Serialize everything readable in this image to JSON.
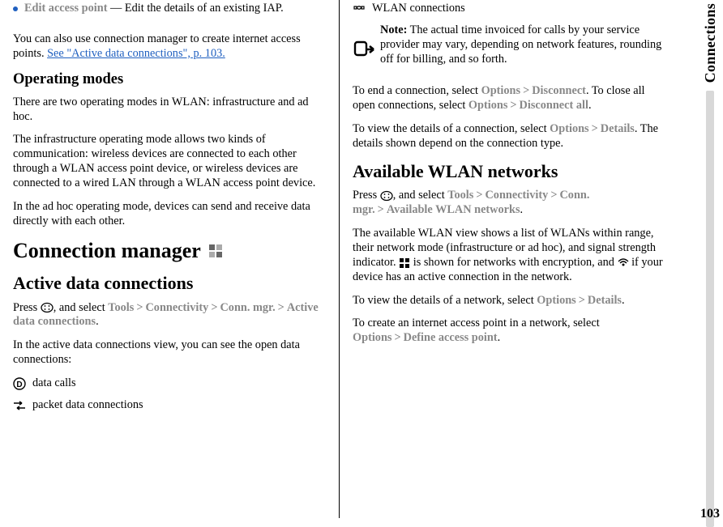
{
  "left": {
    "editAp": {
      "label": "Edit access point",
      "desc": " — Edit the details of an existing IAP."
    },
    "connMgrIntro": {
      "text": "You can also use connection manager to create internet access points. ",
      "link": "See \"Active data connections\", p. 103."
    },
    "opModes": {
      "heading": "Operating modes",
      "p1": "There are two operating modes in WLAN: infrastructure and ad hoc.",
      "p2": "The infrastructure operating mode allows two kinds of communication: wireless devices are connected to each other through a WLAN access point device, or wireless devices are connected to a wired LAN through a WLAN access point device.",
      "p3": "In the ad hoc operating mode, devices can send and receive data directly with each other."
    },
    "connMgr": {
      "heading": "Connection manager"
    },
    "activeDataConn": {
      "heading": "Active data connections",
      "press": "Press ",
      "andSelect": ", and select ",
      "tools": "Tools",
      "connectivity": "Connectivity",
      "connMgr": "Conn. mgr.",
      "adc": "Active data connections",
      "p2": "In the active data connections view, you can see the open data connections:",
      "dataCalls": "data calls",
      "packetData": "packet data connections"
    }
  },
  "right": {
    "wlanConn": "WLAN connections",
    "note": {
      "label": "Note:",
      "text": "  The actual time invoiced for calls by your service provider may vary, depending on network features, rounding off for billing, and so forth."
    },
    "endConn": {
      "t1": "To end a connection, select ",
      "options": "Options",
      "disconnect": "Disconnect",
      "t2": ". To close all open connections, select ",
      "disconnectAll": "Disconnect all",
      "period": "."
    },
    "viewDetails": {
      "t1": "To view the details of a connection, select ",
      "options": "Options",
      "details": "Details",
      "t2": ". The details shown depend on the connection type."
    },
    "availWlan": {
      "heading": "Available WLAN networks",
      "press": "Press ",
      "andSelect": ", and select ",
      "tools": "Tools",
      "connectivity": "Connectivity",
      "connMgr": "Conn. mgr.",
      "awn": "Available WLAN networks",
      "period": ".",
      "p2a": "The available WLAN view shows a list of WLANs within range, their network mode (infrastructure or ad hoc), and signal strength indicator. ",
      "p2b": " is shown for networks with encryption, and ",
      "p2c": " if your device has an active connection in the network.",
      "p3a": "To view the details of a network, select ",
      "options": "Options",
      "details": "Details",
      "p4a": "To create an internet access point in a network, select ",
      "defineAp": "Define access point"
    }
  },
  "side": {
    "label": "Connections",
    "pageNum": "103"
  },
  "gt": ">"
}
